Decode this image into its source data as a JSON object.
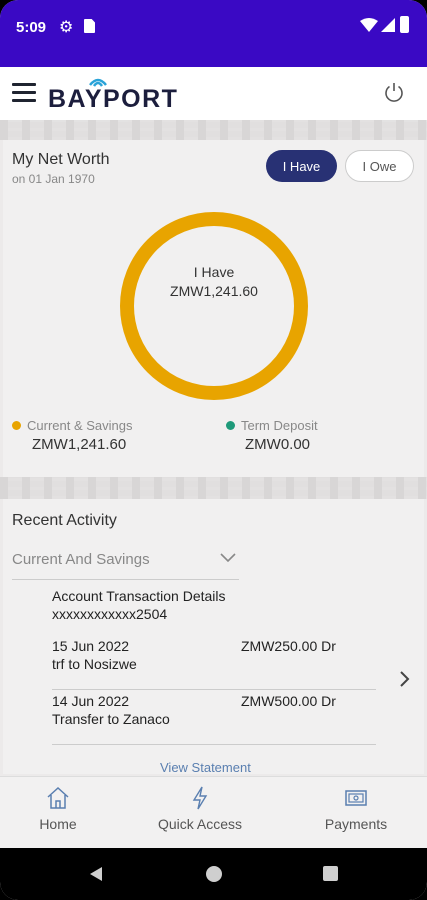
{
  "status_bar": {
    "time": "5:09"
  },
  "app_bar": {
    "logo": "BAYPORT"
  },
  "net_worth": {
    "title": "My Net Worth",
    "date": "on 01 Jan 1970",
    "toggle_have": "I Have",
    "toggle_owe": "I Owe",
    "donut_label": "I Have",
    "donut_value": "ZMW1,241.60",
    "legend": [
      {
        "label": "Current & Savings",
        "amount": "ZMW1,241.60",
        "color": "#e8a400"
      },
      {
        "label": "Term Deposit",
        "amount": "ZMW0.00",
        "color": "#1f9a7a"
      }
    ]
  },
  "recent_activity": {
    "title": "Recent Activity",
    "account_type": "Current And Savings",
    "details_title": "Account Transaction Details",
    "account_number": "xxxxxxxxxxxx2504",
    "transactions": [
      {
        "date": "15 Jun 2022",
        "description": "trf to Nosizwe",
        "amount": "ZMW250.00 Dr"
      },
      {
        "date": "14 Jun 2022",
        "description": "Transfer to Zanaco",
        "amount": "ZMW500.00 Dr"
      }
    ],
    "view_statement": "View Statement"
  },
  "bottom_nav": {
    "home": "Home",
    "quick_access": "Quick Access",
    "payments": "Payments"
  },
  "colors": {
    "status_bar": "#3a09c4",
    "accent_navy": "#283174",
    "donut": "#e8a400",
    "term_deposit": "#1f9a7a"
  }
}
